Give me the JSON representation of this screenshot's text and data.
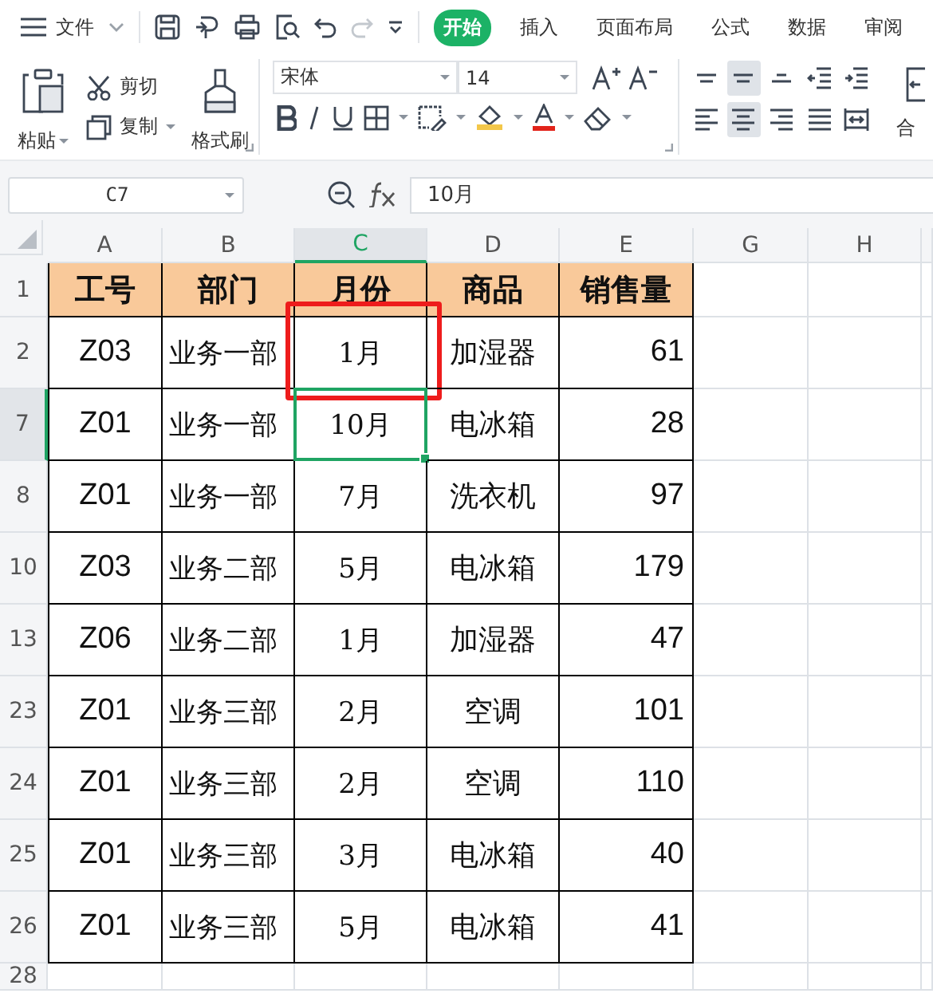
{
  "menu": {
    "file_label": "文件",
    "tabs": [
      {
        "label": "开始",
        "selected": true
      },
      {
        "label": "插入",
        "selected": false
      },
      {
        "label": "页面布局",
        "selected": false
      },
      {
        "label": "公式",
        "selected": false
      },
      {
        "label": "数据",
        "selected": false
      },
      {
        "label": "审阅",
        "selected": false
      }
    ]
  },
  "toolbar": {
    "paste": "粘贴",
    "cut": "剪切",
    "copy": "复制",
    "format_painter": "格式刷",
    "font": "宋体",
    "font_size": "14",
    "merge": "合",
    "align_top_row": [
      {
        "kind": "top",
        "selected": false
      },
      {
        "kind": "middle",
        "selected": true
      },
      {
        "kind": "bottom",
        "selected": false
      },
      {
        "kind": "outdent",
        "selected": false
      },
      {
        "kind": "indent",
        "selected": false
      }
    ],
    "align_bottom_row": [
      {
        "kind": "left",
        "selected": false
      },
      {
        "kind": "center",
        "selected": true
      },
      {
        "kind": "right",
        "selected": false
      },
      {
        "kind": "justify",
        "selected": false
      },
      {
        "kind": "distributed",
        "selected": false
      }
    ]
  },
  "formula_bar": {
    "cell_ref": "C7",
    "value": "10月"
  },
  "sheet": {
    "columns": [
      {
        "label": "A",
        "selected": false,
        "annotated": false
      },
      {
        "label": "B",
        "selected": false,
        "annotated": false
      },
      {
        "label": "C",
        "selected": true,
        "annotated": true
      },
      {
        "label": "D",
        "selected": false,
        "annotated": false
      },
      {
        "label": "E",
        "selected": false,
        "annotated": false
      },
      {
        "label": "G",
        "selected": false,
        "annotated": false
      },
      {
        "label": "H",
        "selected": false,
        "annotated": false
      }
    ],
    "rows": [
      {
        "label": "1",
        "kind": "header",
        "selected": false,
        "cells": [
          "工号",
          "部门",
          "月份",
          "商品",
          "销售量"
        ]
      },
      {
        "label": "2",
        "kind": "data",
        "selected": false,
        "highlight": {
          "kind": "box"
        },
        "cells": [
          "Z03",
          "业务一部",
          "1月",
          "加湿器",
          "61"
        ]
      },
      {
        "label": "7",
        "kind": "data",
        "selected": true,
        "cells": [
          "Z01",
          "业务一部",
          "10月",
          "电冰箱",
          "28"
        ]
      },
      {
        "label": "8",
        "kind": "data",
        "selected": false,
        "cells": [
          "Z01",
          "业务一部",
          "7月",
          "洗衣机",
          "97"
        ]
      },
      {
        "label": "10",
        "kind": "data",
        "selected": false,
        "cells": [
          "Z03",
          "业务二部",
          "5月",
          "电冰箱",
          "179"
        ]
      },
      {
        "label": "13",
        "kind": "data",
        "selected": false,
        "cells": [
          "Z06",
          "业务二部",
          "1月",
          "加湿器",
          "47"
        ]
      },
      {
        "label": "23",
        "kind": "data",
        "selected": false,
        "cells": [
          "Z01",
          "业务三部",
          "2月",
          "空调",
          "101"
        ]
      },
      {
        "label": "24",
        "kind": "data",
        "selected": false,
        "cells": [
          "Z01",
          "业务三部",
          "2月",
          "空调",
          "110"
        ]
      },
      {
        "label": "25",
        "kind": "data",
        "selected": false,
        "cells": [
          "Z01",
          "业务三部",
          "3月",
          "电冰箱",
          "40"
        ]
      },
      {
        "label": "26",
        "kind": "data",
        "selected": false,
        "cells": [
          "Z01",
          "业务三部",
          "5月",
          "电冰箱",
          "41"
        ]
      },
      {
        "label": "28",
        "kind": "empty",
        "selected": false,
        "cells": []
      }
    ]
  }
}
